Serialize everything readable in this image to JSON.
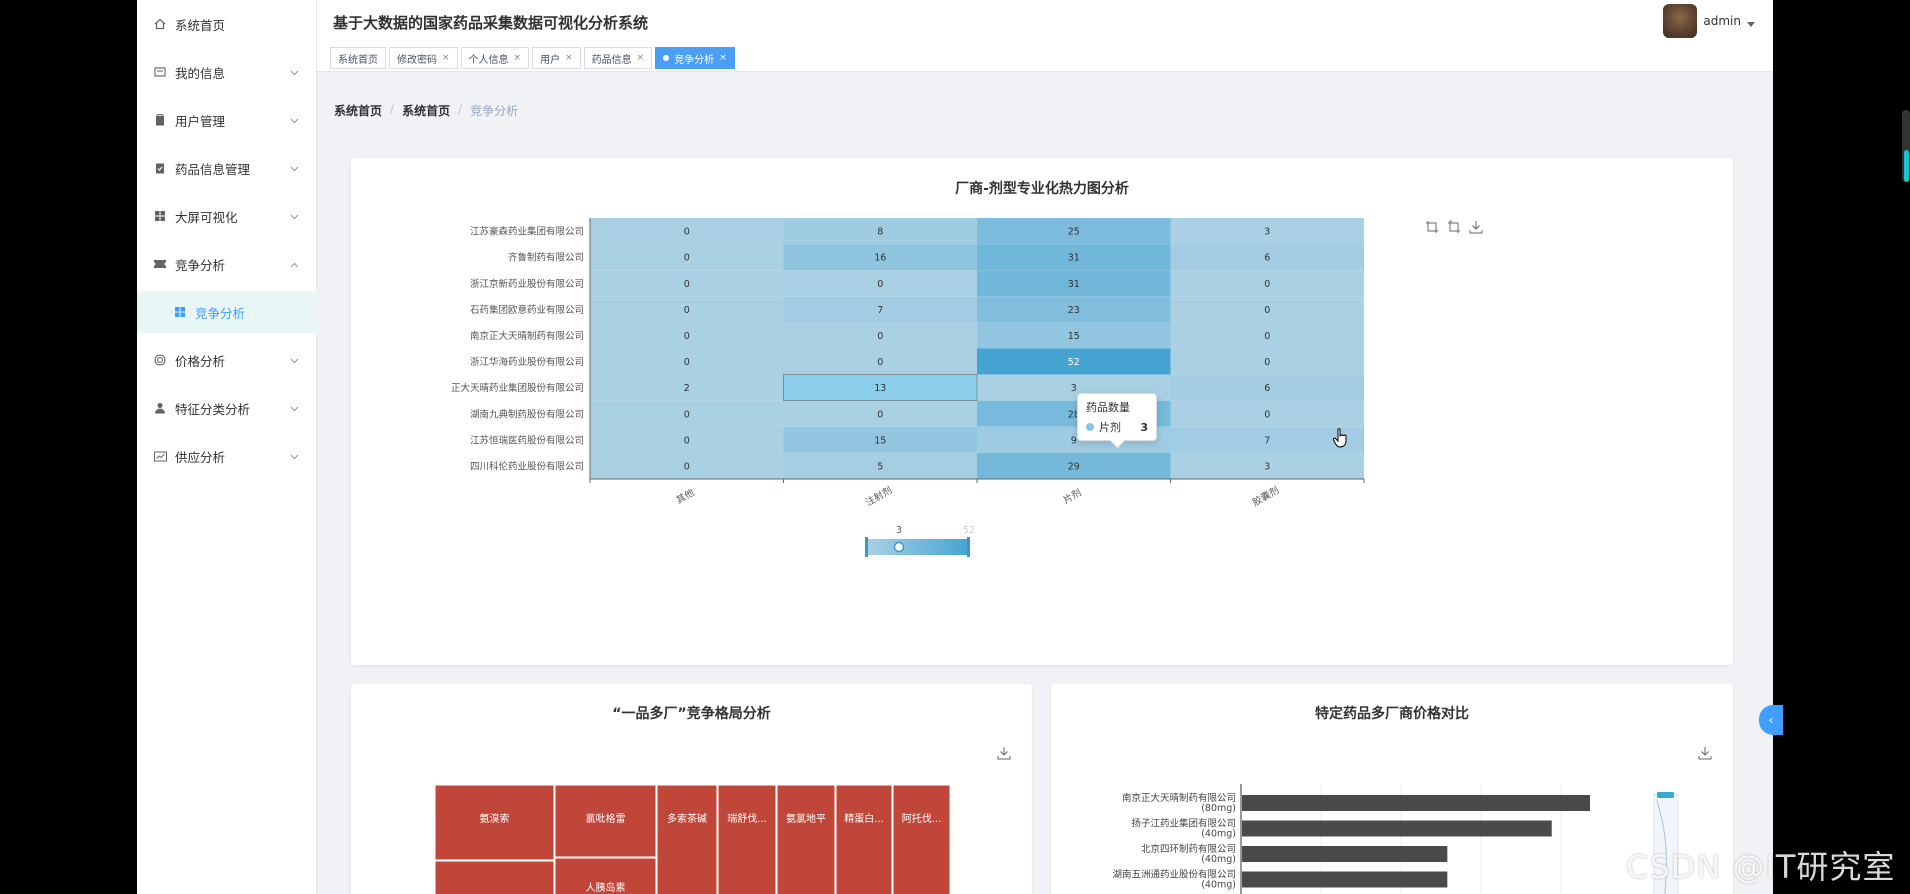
{
  "header": {
    "title": "基于大数据的国家药品采集数据可视化分析系统",
    "user": "admin"
  },
  "tabs": [
    {
      "label": "系统首页",
      "closable": false,
      "active": false
    },
    {
      "label": "修改密码",
      "closable": true,
      "active": false
    },
    {
      "label": "个人信息",
      "closable": true,
      "active": false
    },
    {
      "label": "用户",
      "closable": true,
      "active": false
    },
    {
      "label": "药品信息",
      "closable": true,
      "active": false
    },
    {
      "label": "竞争分析",
      "closable": true,
      "active": true
    }
  ],
  "sidebar": {
    "items": [
      {
        "label": "系统首页",
        "icon": "home-icon",
        "expandable": false
      },
      {
        "label": "我的信息",
        "icon": "id-card-icon",
        "expandable": true
      },
      {
        "label": "用户管理",
        "icon": "clipboard-icon",
        "expandable": true
      },
      {
        "label": "药品信息管理",
        "icon": "checklist-icon",
        "expandable": true
      },
      {
        "label": "大屏可视化",
        "icon": "grid-icon",
        "expandable": true
      },
      {
        "label": "竞争分析",
        "icon": "ticket-icon",
        "expandable": true,
        "expanded": true
      },
      {
        "label": "竞争分析",
        "icon": "grid-icon",
        "sub": true
      },
      {
        "label": "价格分析",
        "icon": "target-icon",
        "expandable": true
      },
      {
        "label": "特征分类分析",
        "icon": "user-icon",
        "expandable": true
      },
      {
        "label": "供应分析",
        "icon": "chart-card-icon",
        "expandable": true
      }
    ]
  },
  "breadcrumb": [
    "系统首页",
    "系统首页",
    "竞争分析"
  ],
  "chart_data": [
    {
      "type": "heatmap",
      "title": "厂商-剂型专业化热力图分析",
      "y_categories": [
        "江苏豪森药业集团有限公司",
        "齐鲁制药有限公司",
        "浙江京新药业股份有限公司",
        "石药集团欧意药业有限公司",
        "南京正大天晴制药有限公司",
        "浙江华海药业股份有限公司",
        "正大天晴药业集团股份有限公司",
        "湖南九典制药股份有限公司",
        "江苏恒瑞医药股份有限公司",
        "四川科伦药业股份有限公司"
      ],
      "x_categories": [
        "其他",
        "注射剂",
        "片剂",
        "胶囊剂"
      ],
      "values": [
        [
          0,
          8,
          25,
          3
        ],
        [
          0,
          16,
          31,
          6
        ],
        [
          0,
          0,
          31,
          0
        ],
        [
          0,
          7,
          23,
          0
        ],
        [
          0,
          0,
          15,
          0
        ],
        [
          0,
          0,
          52,
          0
        ],
        [
          2,
          13,
          3,
          6
        ],
        [
          0,
          0,
          28,
          0
        ],
        [
          0,
          15,
          9,
          7
        ],
        [
          0,
          5,
          29,
          3
        ]
      ],
      "visual_map": {
        "min_label": "3",
        "max_label": "52",
        "min": 3,
        "max": 52
      },
      "tooltip": {
        "title": "药品数量",
        "series": "片剂",
        "value": "3"
      }
    },
    {
      "type": "treemap",
      "title": "“一品多厂”竞争格局分析",
      "items": [
        "氨溴索",
        "氯吡格雷",
        "多索茶碱",
        "瑞舒伐...",
        "氨氯地平",
        "精蛋白...",
        "阿托伐...",
        "人胰岛素"
      ]
    },
    {
      "type": "bar",
      "title": "特定药品多厂商价格对比",
      "categories": [
        "南京正大天晴制药有限公司\n(80mg)",
        "扬子江药业集团有限公司\n(40mg)",
        "北京四环制药有限公司\n(40mg)",
        "湖南五洲通药业股份有限公司\n(40mg)"
      ],
      "values": [
        100,
        89,
        59,
        59
      ]
    }
  ],
  "colors": {
    "accent": "#409eff",
    "treemap": "#c1463a",
    "bar": "#4a4a4a"
  },
  "watermark": "CSDN @IT研究室"
}
